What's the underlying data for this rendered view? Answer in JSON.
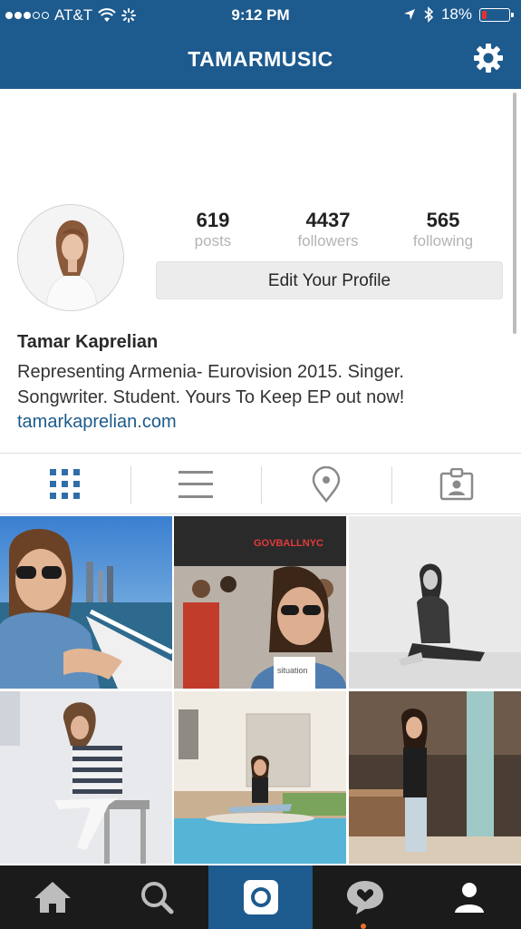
{
  "status_bar": {
    "carrier": "AT&T",
    "time": "9:12 PM",
    "battery_percent": "18%",
    "battery_level": 0.18
  },
  "header": {
    "title": "TAMARMUSIC"
  },
  "profile": {
    "stats": [
      {
        "value": "619",
        "label": "posts"
      },
      {
        "value": "4437",
        "label": "followers"
      },
      {
        "value": "565",
        "label": "following"
      }
    ],
    "edit_button": "Edit Your Profile",
    "name": "Tamar Kaprelian",
    "bio_line1": "Representing Armenia- Eurovision 2015. Singer.",
    "bio_line2": "Songwriter. Student. Yours To Keep EP out now!",
    "website": "tamarkaprelian.com"
  },
  "tabs": [
    "grid-view",
    "list-view",
    "location-view",
    "tagged-view"
  ],
  "photos": [
    {
      "name": "photo-boat-sunglasses"
    },
    {
      "name": "photo-festival-stage"
    },
    {
      "name": "photo-bw-sitting"
    },
    {
      "name": "photo-stool-stripes"
    },
    {
      "name": "photo-pool-house"
    },
    {
      "name": "photo-patio-pose"
    }
  ],
  "photo_texts": {
    "stage_banner": "GOVBALLNYC",
    "cup_text": "situation"
  },
  "bottom_nav": [
    "home",
    "search",
    "camera",
    "activity",
    "profile"
  ],
  "colors": {
    "brand_blue": "#1d5a8e",
    "link_blue": "#1c5b8c",
    "nav_dark": "#1b1b1b",
    "battery_red": "#e0322c"
  }
}
